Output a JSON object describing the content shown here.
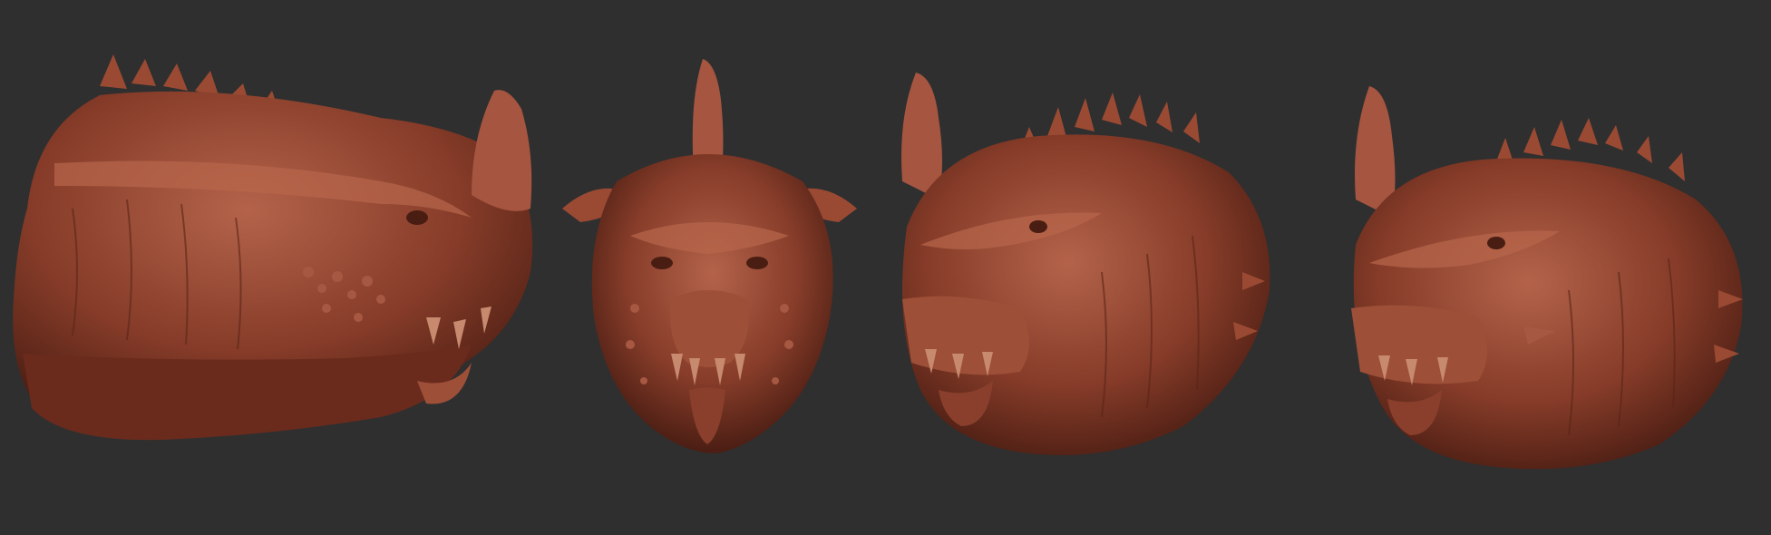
{
  "scene": {
    "background_color": "#2f2f2f",
    "material_color": "#8a3f2c",
    "material_highlight": "#b4634a",
    "material_shadow": "#4a1d13"
  },
  "renders": [
    {
      "view": "side"
    },
    {
      "view": "front"
    },
    {
      "view": "three-quarter"
    },
    {
      "view": "three-quarter"
    }
  ]
}
